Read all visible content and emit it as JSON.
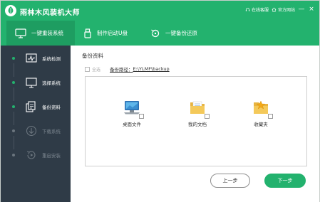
{
  "app": {
    "title": "雨林木风装机大师",
    "links": {
      "online_service": "在线客服",
      "official_site": "官方网站"
    },
    "window_controls": {
      "minimize": "—",
      "close": "×"
    }
  },
  "nav": {
    "tabs": [
      {
        "label": "一键重装系统",
        "icon": "monitor-icon",
        "active": true
      },
      {
        "label": "制作启动U盘",
        "icon": "usb-drive-icon",
        "active": false
      },
      {
        "label": "一键备份还原",
        "icon": "backup-restore-icon",
        "active": false
      }
    ]
  },
  "sidebar": {
    "steps": [
      {
        "label": "系统检测",
        "icon": "system-check-icon",
        "enabled": true
      },
      {
        "label": "选择系统",
        "icon": "select-system-icon",
        "enabled": true
      },
      {
        "label": "备份资料",
        "icon": "backup-data-icon",
        "enabled": true
      },
      {
        "label": "下载系统",
        "icon": "download-icon",
        "enabled": false
      },
      {
        "label": "重启安装",
        "icon": "restart-install-icon",
        "enabled": false
      }
    ]
  },
  "main": {
    "section_title": "备份资料",
    "select_all": "全选",
    "path_label": "备份路径：",
    "path_value": "E:\\YLMF\\backup",
    "items": [
      {
        "label": "桌面文件",
        "icon": "desktop-icon"
      },
      {
        "label": "我的文档",
        "icon": "documents-folder-icon"
      },
      {
        "label": "收藏夹",
        "icon": "favorites-folder-icon"
      }
    ],
    "prev_button": "上一步",
    "next_button": "下一步"
  },
  "colors": {
    "brand_green": "#23b26e",
    "sidebar_bg": "#2f3b47"
  }
}
